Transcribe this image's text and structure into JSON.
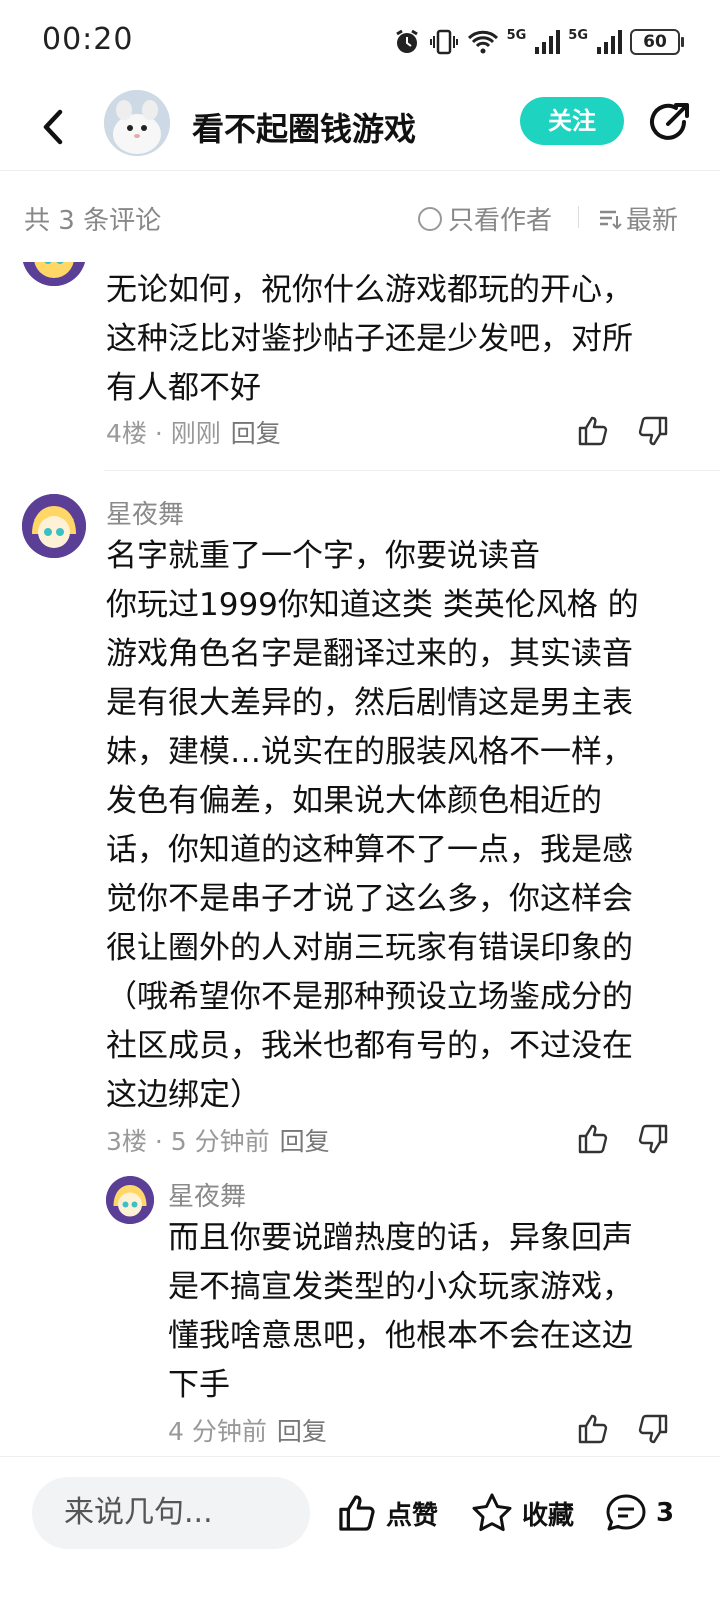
{
  "status": {
    "time": "00:20",
    "battery": "60",
    "net1": "5G",
    "net2": "5G"
  },
  "header": {
    "title": "看不起圈钱游戏",
    "follow_label": "关注"
  },
  "filter": {
    "count_label": "共 3 条评论",
    "author_only": "只看作者",
    "sort": "最新"
  },
  "comments": [
    {
      "text": "无论如何，祝你什么游戏都玩的开心，\n这种泛比对鉴抄帖子还是少发吧，对所\n有人都不好",
      "floor": "4楼",
      "time": "刚刚",
      "reply_label": "回复"
    },
    {
      "user": "星夜舞",
      "text": "名字就重了一个字，你要说读音\n你玩过1999你知道这类 类英伦风格 的\n游戏角色名字是翻译过来的，其实读音\n是有很大差异的，然后剧情这是男主表\n妹，建模…说实在的服装风格不一样，\n发色有偏差，如果说大体颜色相近的\n话，你知道的这种算不了一点，我是感\n觉你不是串子才说了这么多，你这样会\n很让圈外的人对崩三玩家有错误印象的\n（哦希望你不是那种预设立场鉴成分的\n社区成员，我米也都有号的，不过没在\n这边绑定）",
      "floor": "3楼",
      "time": "5 分钟前",
      "reply_label": "回复"
    }
  ],
  "sub_reply": {
    "user": "星夜舞",
    "text": "而且你要说蹭热度的话，异象回声\n是不搞宣发类型的小众玩家游戏，\n懂我啥意思吧，他根本不会在这边\n下手",
    "time": "4 分钟前",
    "reply_label": "回复"
  },
  "bottom": {
    "input_placeholder": "来说几句...",
    "like_label": "点赞",
    "fav_label": "收藏",
    "comment_count": "3"
  },
  "colors": {
    "accent": "#1ed3c0",
    "muted": "#999999"
  }
}
